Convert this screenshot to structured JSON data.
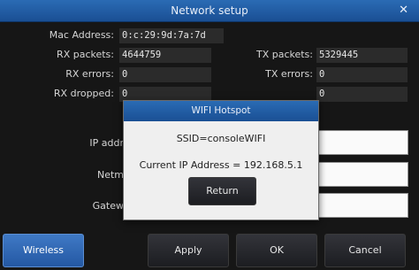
{
  "window": {
    "title": "Network setup",
    "close_glyph": "✕"
  },
  "fields": {
    "mac_label": "Mac Address:",
    "mac_value": "0:c:29:9d:7a:7d",
    "rx_packets_label": "RX packets:",
    "rx_packets_value": "4644759",
    "tx_packets_label": "TX packets:",
    "tx_packets_value": "5329445",
    "rx_errors_label": "RX errors:",
    "rx_errors_value": "0",
    "tx_errors_label": "TX errors:",
    "tx_errors_value": "0",
    "rx_dropped_label": "RX dropped:",
    "rx_dropped_value": "0",
    "tx_dropped_value": "0",
    "ip_label": "IP addr",
    "netmask_label": "Netm",
    "gateway_label": "Gatew"
  },
  "dialog": {
    "title": "WIFI Hotspot",
    "ssid": "SSID=consoleWIFI",
    "ip": "Current IP Address = 192.168.5.1",
    "return_label": "Return"
  },
  "buttons": {
    "wireless_hotspot": "Wireless Hotspot",
    "apply": "Apply",
    "ok": "OK",
    "cancel": "Cancel"
  },
  "colors": {
    "title_bar": "#1f5aa6",
    "active_button": "#2f6ab8",
    "background": "#161616"
  }
}
